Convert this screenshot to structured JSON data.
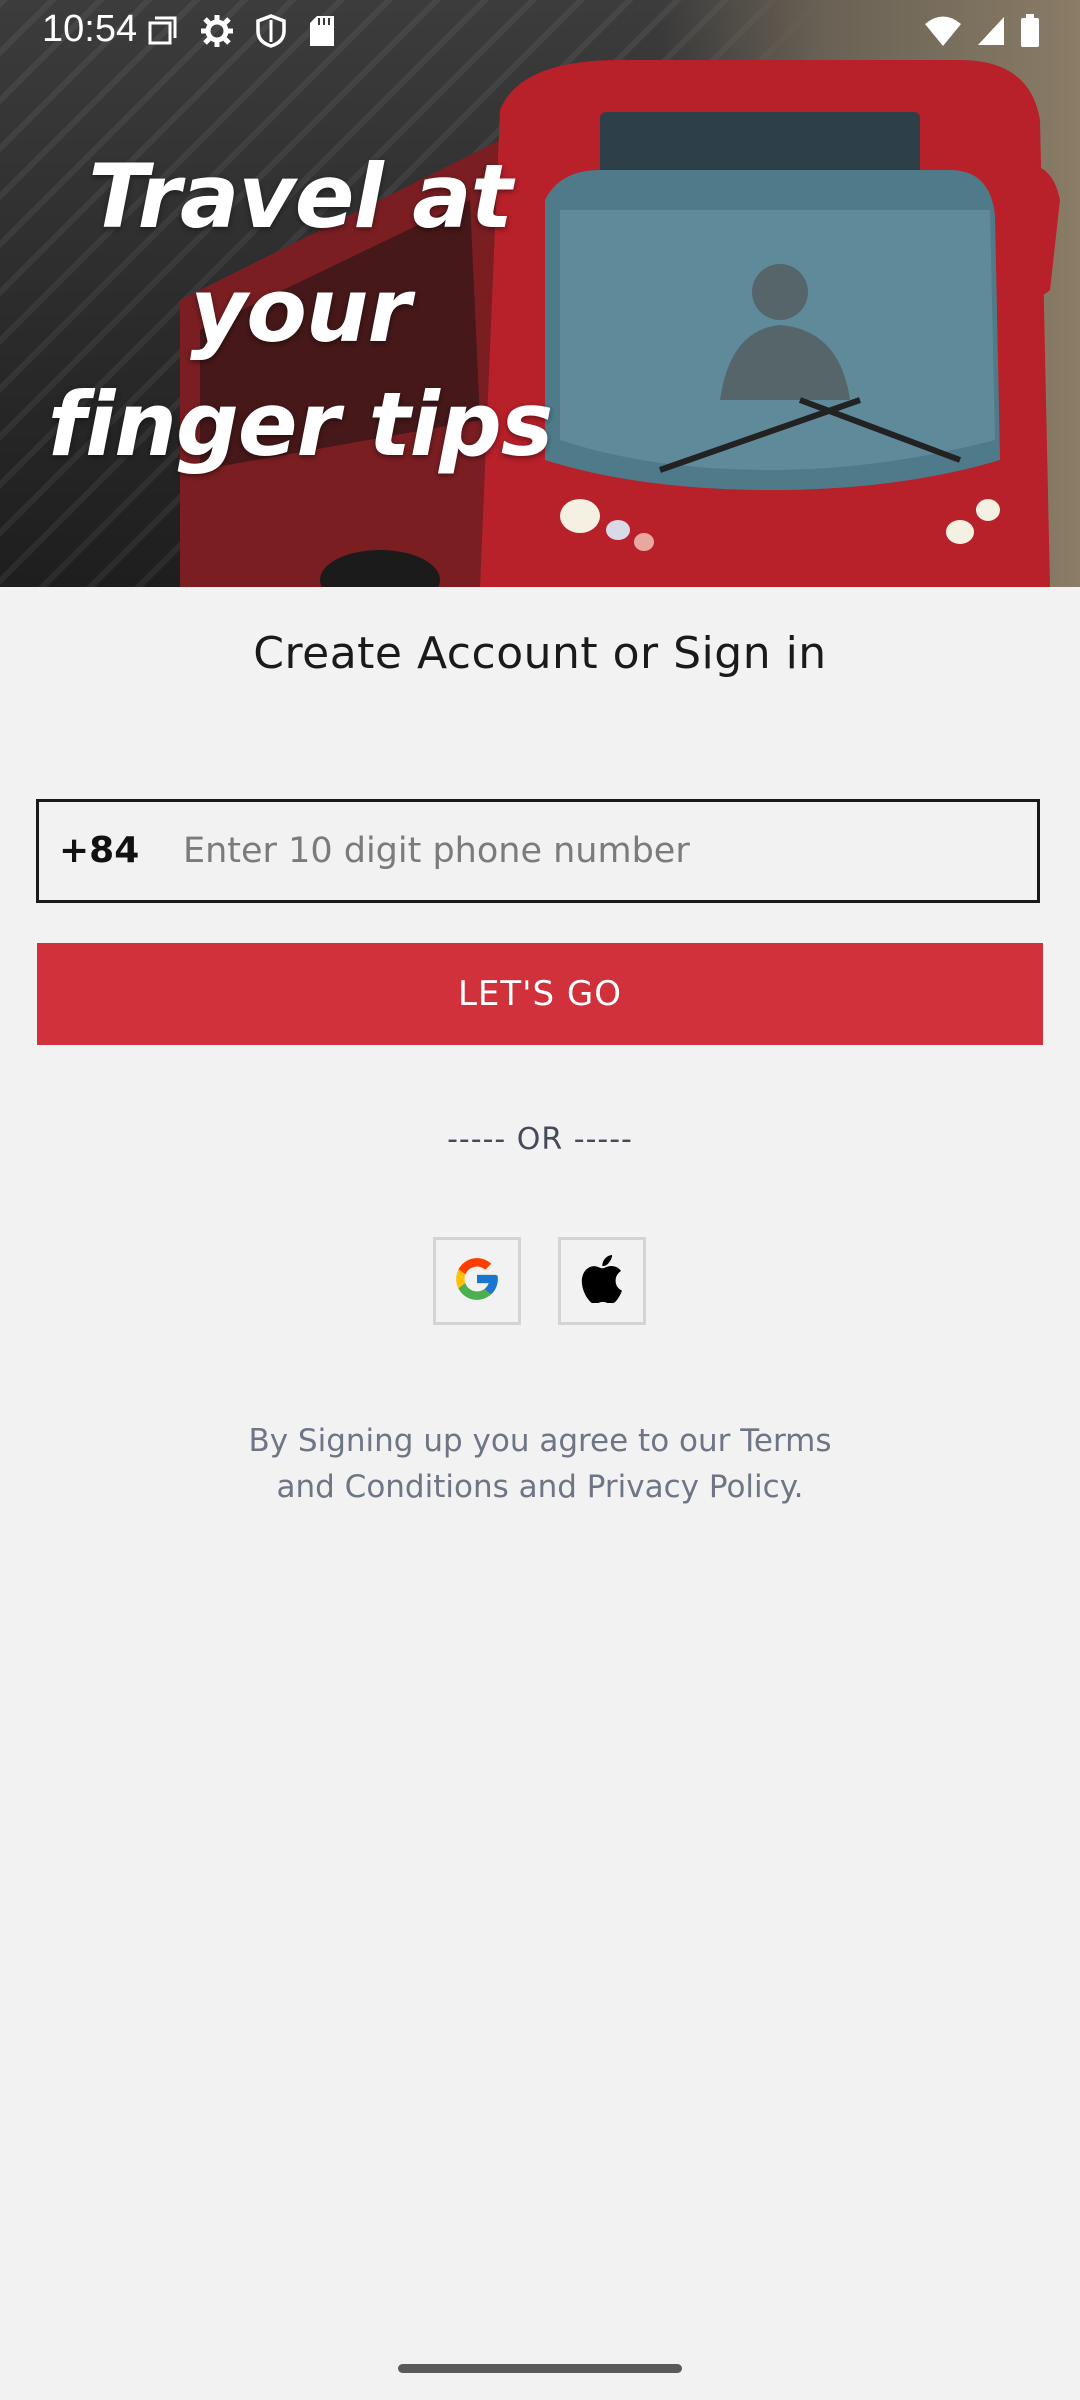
{
  "status_bar": {
    "time": "10:54",
    "left_icons": [
      "screenshot-icon",
      "gear-icon",
      "shield-icon",
      "sd-card-icon"
    ],
    "right_icons": [
      "wifi-icon",
      "signal-icon",
      "battery-icon"
    ]
  },
  "hero": {
    "headline_lines": [
      "Travel at",
      "your",
      "finger tips"
    ],
    "background": "red-bus-photo"
  },
  "form": {
    "title": "Create Account or Sign in",
    "country_code": "+84",
    "phone_placeholder": "Enter 10 digit phone number",
    "phone_value": "",
    "submit_label": "LET'S GO"
  },
  "divider": {
    "label": "----- OR -----"
  },
  "social": {
    "google_icon": "google-icon",
    "apple_icon": "apple-icon"
  },
  "terms": {
    "text": "By Signing up you agree to our Terms and Conditions and Privacy Policy."
  },
  "colors": {
    "primary": "#d1313b",
    "background": "#f2f2f2",
    "text": "#1a1a1a",
    "muted_text": "#6e7585"
  }
}
